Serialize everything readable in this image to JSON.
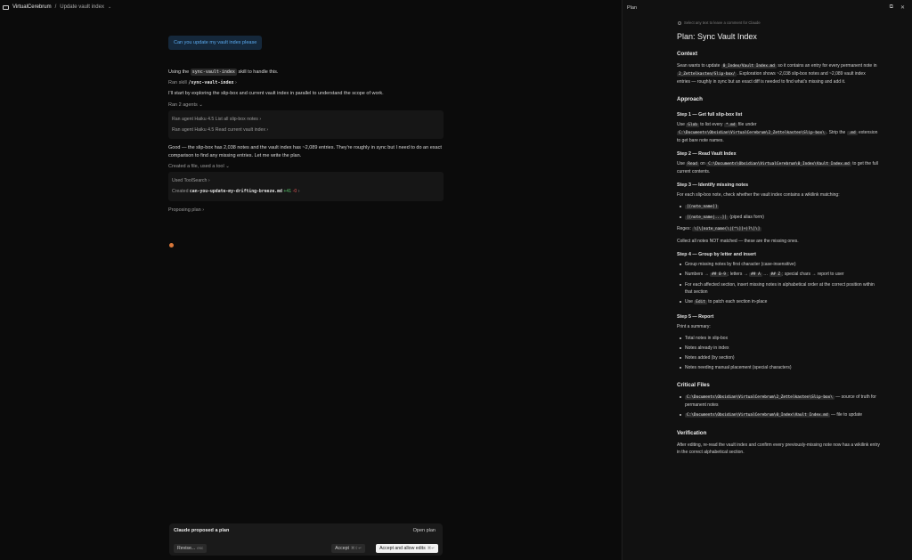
{
  "breadcrumb": {
    "project": "VirtualCerebrum",
    "separator": "/",
    "page": "Update vault index"
  },
  "conversation": {
    "user_message": "Can you update my vault index please",
    "using_pre": "Using the",
    "using_skill": "sync-vault-index",
    "using_post": "skill to handle this.",
    "ran_skill_label": "Ran skill",
    "ran_skill_name": "/sync-vault-index",
    "start_text": "I'll start by exploring the slip-box and current vault index in parallel to understand the scope of work.",
    "ran_agents_label": "Ran 2 agents",
    "agents": [
      "Ran agent Haiku 4.5 List all slip-box notes",
      "Ran agent Haiku 4.5 Read current vault index"
    ],
    "good_text": "Good — the slip-box has 2,038 notes and the vault index has ~2,089 entries. They're roughly in sync but I need to do an exact comparison to find any missing entries. Let me write the plan.",
    "created_label": "Created a file, used a tool",
    "used_tool": "Used ToolSearch",
    "created_pre": "Created",
    "created_file": "can-you-update-my-drifting-breeze.md",
    "added": "+41",
    "removed": "-0",
    "proposing": "Proposing plan"
  },
  "proposal": {
    "title": "Claude proposed a plan",
    "open_plan": "Open plan",
    "revise": "Revise...",
    "revise_key": "esc",
    "accept": "Accept",
    "accept_key": "⌘⇧↵",
    "accept_all": "Accept and allow edits",
    "accept_all_key": "⌘↵"
  },
  "plan_panel": {
    "header": "Plan",
    "hint": "Select any text to leave a comment for Claude",
    "title": "Plan: Sync Vault Index",
    "context_h": "Context",
    "context_1": "Sean wants to update",
    "context_code1": "0_Index/Vault Index.md",
    "context_2": "so it contains an entry for every permanent note in",
    "context_code2": "2_Zettelkasten/Slip-box/",
    "context_3": ". Exploration shows ~2,038 slip-box notes and ~2,089 vault index entries — roughly in sync but an exact diff is needed to find what's missing and add it.",
    "approach_h": "Approach",
    "step1_h": "Step 1 — Get full slip-box list",
    "step1_a": "Use",
    "step1_code1": "Glob",
    "step1_b": "to list every",
    "step1_code2": "*.md",
    "step1_c": "file under",
    "step1_code3": "C:\\Documents\\Obsidian\\VirtualCerebrum\\2_Zettelkasten\\Slip-box\\",
    "step1_d": ". Strip the",
    "step1_code4": ".md",
    "step1_e": "extension to get bare note names.",
    "step2_h": "Step 2 — Read Vault Index",
    "step2_a": "Use",
    "step2_code1": "Read",
    "step2_b": "on",
    "step2_code2": "C:\\Documents\\Obsidian\\VirtualCerebrum\\0_Index\\Vault Index.md",
    "step2_c": "to get the full current contents.",
    "step3_h": "Step 3 — Identify missing notes",
    "step3_a": "For each slip-box note, check whether the vault index contains a wikilink matching:",
    "step3_b1": "[[note_name]]",
    "step3_b2": "[[note_name|...]]",
    "step3_b2_post": "(piped alias form)",
    "step3_regex_label": "Regex:",
    "step3_regex": "\\[\\[note_name(\\|[^\\]]+)?\\]\\]",
    "step3_c": "Collect all notes NOT matched — these are the missing ones.",
    "step4_h": "Step 4 — Group by letter and insert",
    "step4_l1": "Group missing notes by first character (case-insensitive)",
    "step4_l2_a": "Numbers →",
    "step4_l2_c1": "## 0-9",
    "step4_l2_b": "; letters →",
    "step4_l2_c2": "## A",
    "step4_l2_c": "…",
    "step4_l2_c3": "## Z",
    "step4_l2_d": "; special chars → report to user",
    "step4_l3": "For each affected section, insert missing notes in alphabetical order at the correct position within that section",
    "step4_l4_a": "Use",
    "step4_l4_code": "Edit",
    "step4_l4_b": "to patch each section in-place",
    "step5_h": "Step 5 — Report",
    "step5_a": "Print a summary:",
    "step5_items": [
      "Total notes in slip-box",
      "Notes already in index",
      "Notes added (by section)",
      "Notes needing manual placement (special characters)"
    ],
    "critical_h": "Critical Files",
    "critical_1_code": "C:\\Documents\\Obsidian\\VirtualCerebrum\\2_Zettelkasten\\Slip-box\\",
    "critical_1_desc": "— source of truth for permanent notes",
    "critical_2_code": "C:\\Documents\\Obsidian\\VirtualCerebrum\\0_Index\\Vault Index.md",
    "critical_2_desc": "— file to update",
    "verification_h": "Verification",
    "verification": "After editing, re-read the vault index and confirm every previously-missing note now has a wikilink entry in the correct alphabetical section."
  }
}
